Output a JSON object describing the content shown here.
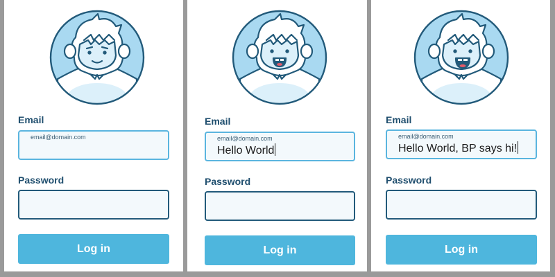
{
  "colors": {
    "background": "#9a9a9a",
    "label": "#1f4e6e",
    "field_border": "#225a7a",
    "field_focus_border": "#5ab5df",
    "button": "#4eb6dd",
    "avatar_fill": "#a9d9f1"
  },
  "panels": [
    {
      "avatar_icon": "yeti-smile-icon",
      "email_label": "Email",
      "email_placeholder": "email@domain.com",
      "email_value": "",
      "password_label": "Password",
      "login_label": "Log in"
    },
    {
      "avatar_icon": "yeti-open-mouth-icon",
      "email_label": "Email",
      "email_placeholder": "email@domain.com",
      "email_value": "Hello World",
      "password_label": "Password",
      "login_label": "Log in"
    },
    {
      "avatar_icon": "yeti-open-mouth-icon",
      "email_label": "Email",
      "email_placeholder": "email@domain.com",
      "email_value": "Hello World, BP says hi!",
      "password_label": "Password",
      "login_label": "Log in"
    }
  ]
}
